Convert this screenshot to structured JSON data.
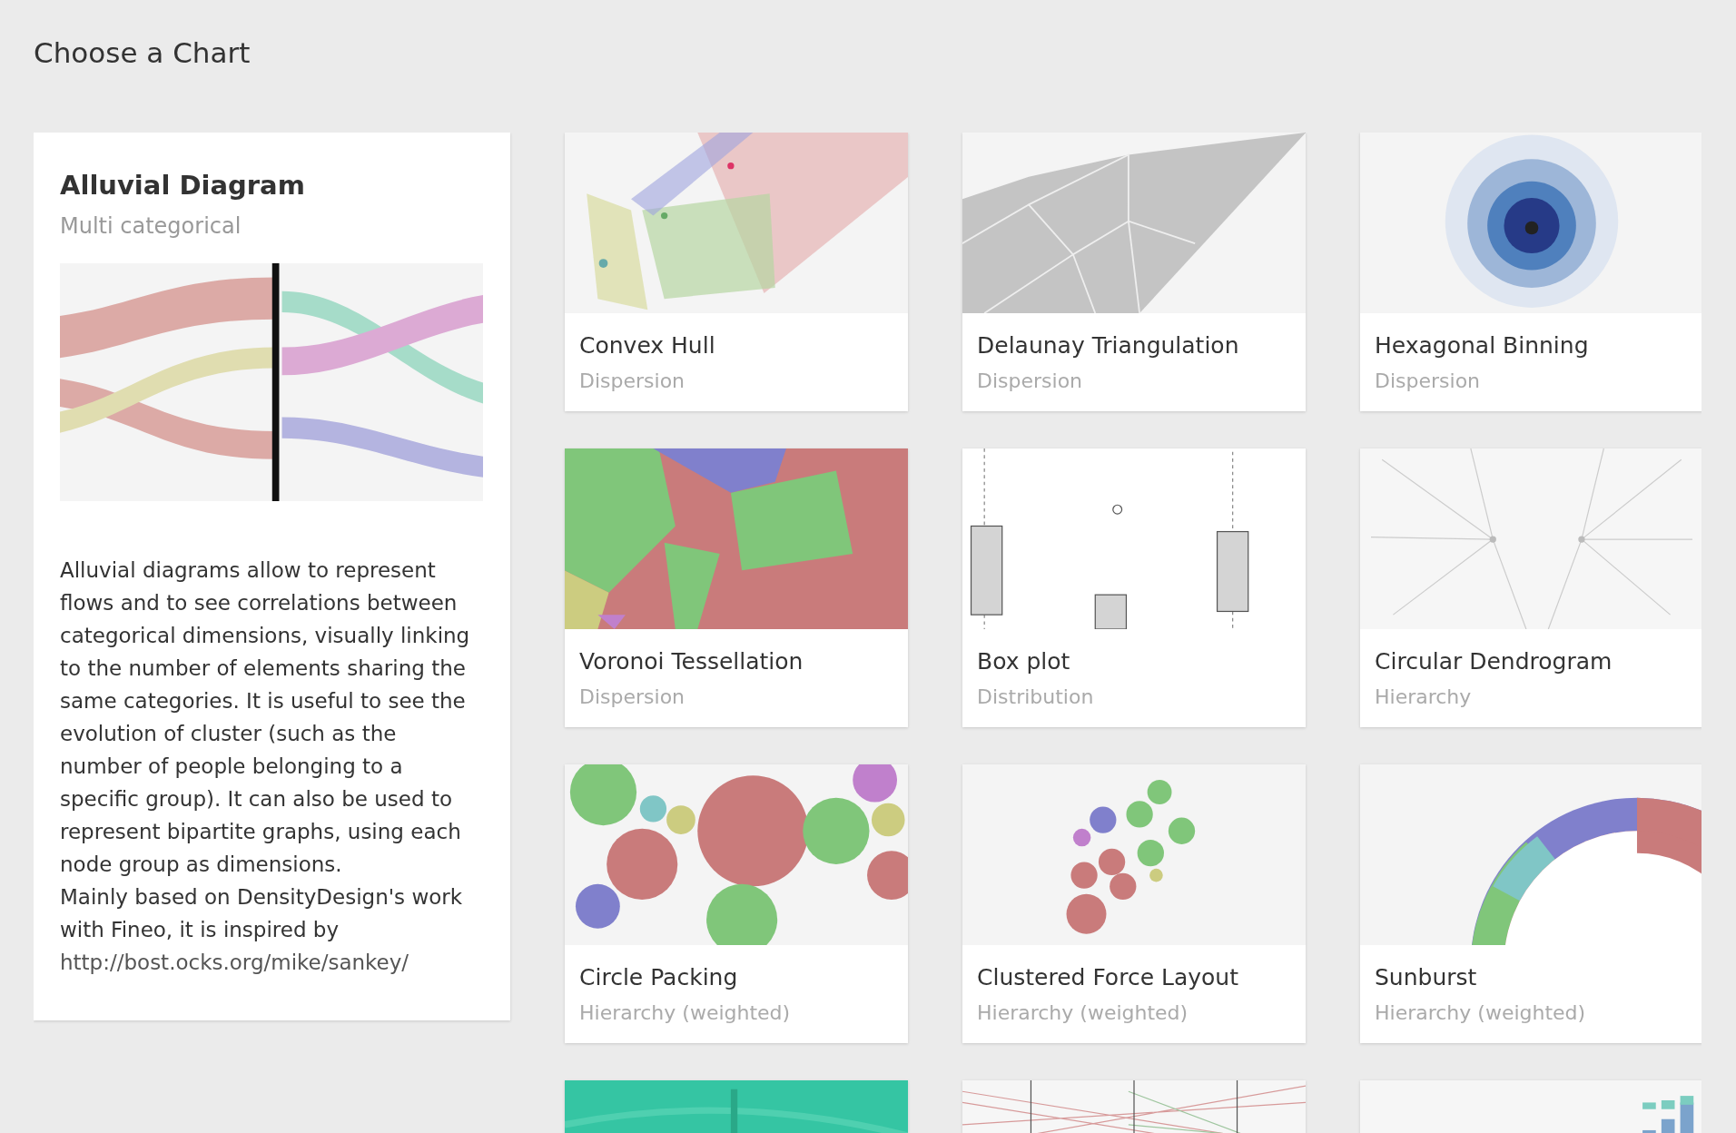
{
  "page_title": "Choose a Chart",
  "featured": {
    "title": "Alluvial Diagram",
    "category": "Multi categorical",
    "thumbnail": {
      "kind": "picture"
    },
    "description": "Alluvial diagrams allow to represent flows and to see correlations between categorical dimensions, visually linking to the number of elements sharing the same categories. It is useful to see the evolution of cluster (such as the number of people belonging to a specific group). It can also be used to represent bipartite graphs, using each node group as dimensions.",
    "credit": "Mainly based on DensityDesign's work with Fineo, it is inspired by",
    "link": "http://bost.ocks.org/mike/sankey/"
  },
  "charts": [
    {
      "title": "Convex Hull",
      "category": "Dispersion",
      "thumbnail": {
        "kind": "picture"
      }
    },
    {
      "title": "Delaunay Triangulation",
      "category": "Dispersion",
      "thumbnail": {
        "kind": "picture"
      }
    },
    {
      "title": "Hexagonal Binning",
      "category": "Dispersion",
      "thumbnail": {
        "kind": "picture"
      }
    },
    {
      "title": "Voronoi Tessellation",
      "category": "Dispersion",
      "thumbnail": {
        "kind": "picture"
      }
    },
    {
      "title": "Box plot",
      "category": "Distribution",
      "thumbnail": {
        "kind": "picture"
      }
    },
    {
      "title": "Circular Dendrogram",
      "category": "Hierarchy",
      "thumbnail": {
        "kind": "picture"
      }
    },
    {
      "title": "Circle Packing",
      "category": "Hierarchy (weighted)",
      "thumbnail": {
        "kind": "picture"
      }
    },
    {
      "title": "Clustered Force Layout",
      "category": "Hierarchy (weighted)",
      "thumbnail": {
        "kind": "picture"
      }
    },
    {
      "title": "Sunburst",
      "category": "Hierarchy (weighted)",
      "thumbnail": {
        "kind": "picture"
      }
    },
    {
      "thumbnail": {
        "kind": "picture"
      }
    },
    {
      "thumbnail": {
        "kind": "picture"
      }
    },
    {
      "thumbnail": {
        "kind": "picture"
      }
    }
  ]
}
